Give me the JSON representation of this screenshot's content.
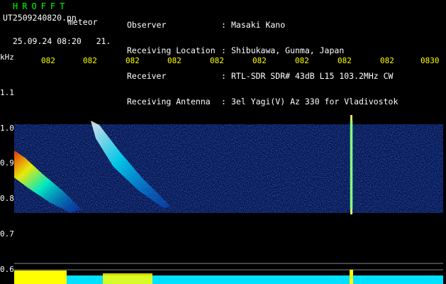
{
  "header": {
    "title": "HROFFT",
    "filename": "UT2509240820.pn",
    "mode": "meteor",
    "date_time": "25.09.24 08:20",
    "frame_num": "21."
  },
  "station": [
    {
      "key": "Observer",
      "value": "Masaki Kano"
    },
    {
      "key": "Receiving Location",
      "value": "Shibukawa, Gunma, Japan"
    },
    {
      "key": "Receiver",
      "value": "RTL-SDR SDR# 43dB L15 103.2MHz CW"
    },
    {
      "key": "Receiving Antenna",
      "value": "3el Yagi(V) Az 330 for Vladivostok"
    }
  ],
  "spectrogram": {
    "freq_unit": "kHz",
    "freq_ticks": [
      "1.1",
      "1.0",
      "0.9",
      "0.8",
      "0.7",
      "0.6"
    ],
    "time_ticks": [
      "082",
      "082",
      "082",
      "082",
      "082",
      "082",
      "082",
      "082",
      "082",
      "0830"
    ],
    "colors": {
      "text": "#ffffff",
      "title": "#00ff00",
      "time_ticks": "#ffff00",
      "grid": "#888888",
      "spectrum": "#00e0ff",
      "peak": "#ffff00"
    }
  }
}
